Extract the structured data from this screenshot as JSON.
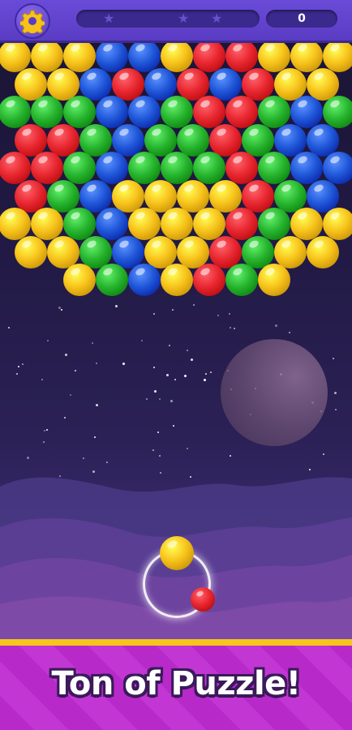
{
  "header": {
    "settings_icon": "gear-icon",
    "progress_stars": [
      "star-icon",
      "star-icon",
      "star-icon"
    ],
    "progress_fraction": 0.0,
    "score": "0"
  },
  "colors": {
    "Y": "#f7c21a",
    "R": "#e8262f",
    "G": "#27b42e",
    "B": "#1f56d8",
    "banner": "#c236d3",
    "banner_stripe": "#f7c61c",
    "topbar": "#5a3cc4"
  },
  "board": {
    "rows": [
      "YYYBBYRRYYY",
      "YYBRBRBRYY",
      "GGGBBGRRGBG",
      "RRGBGGRGBB",
      "RRGBGGGRGBB",
      "RGBYYYYRGB",
      "YYGBYYYRGYY",
      "YYGBYYRGYY",
      "YGBYRGY"
    ]
  },
  "shooter": {
    "current_color": "Y",
    "next_color": "R"
  },
  "banner": {
    "title": "Ton of Puzzle!"
  }
}
